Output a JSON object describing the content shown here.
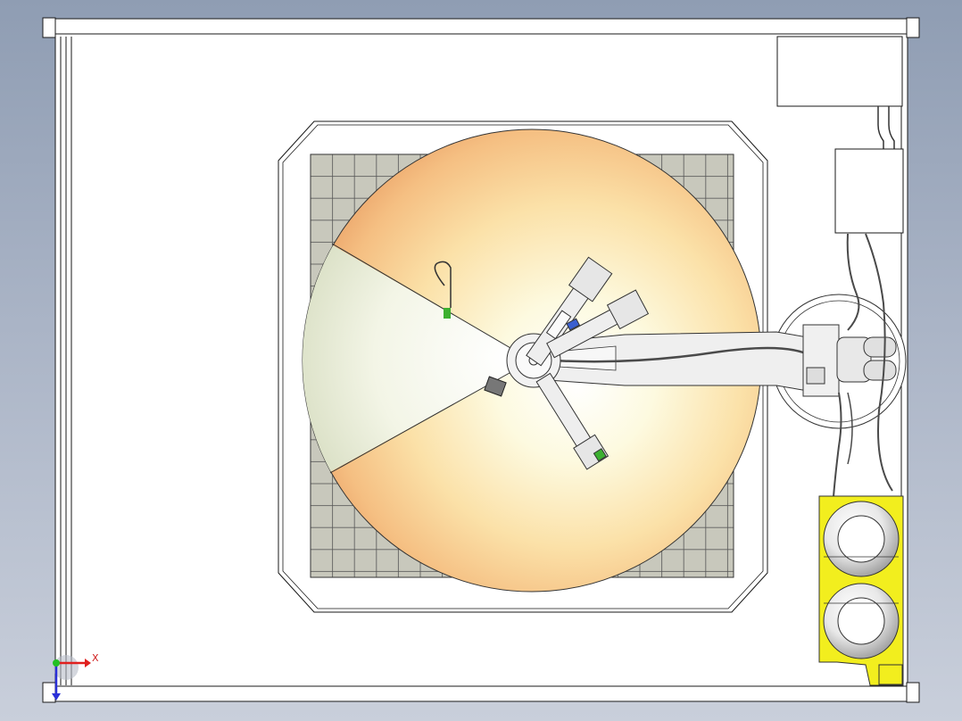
{
  "viewport": {
    "background_gradient": [
      "#8f9db3",
      "#aab4c6",
      "#c9cfdb"
    ]
  },
  "triad": {
    "x_label": "X",
    "x_color": "#e0201e",
    "y_color": "#2a30d8",
    "z_color": "#22c022"
  },
  "colors": {
    "enclosure_fill": "#ffffff",
    "edge_line": "#1a1a1a",
    "floor_tile": "#c8c8bc",
    "dome_warm": "#f3b070",
    "dome_light": "#fbf8d8",
    "dome_wedge": "#e7ecd6",
    "robot_body": "#ededed",
    "tool_accent_blue": "#3a5fd0",
    "tool_accent_green": "#3cb030",
    "cable": "#4a4a4a",
    "reel_holder": "#f2ee1e",
    "reel": "#e4e4e4"
  },
  "model_parts": [
    "enclosure-frame",
    "work-floor-grid",
    "turntable-dome",
    "robot-arm",
    "tool-head",
    "cable-reel-holder"
  ]
}
